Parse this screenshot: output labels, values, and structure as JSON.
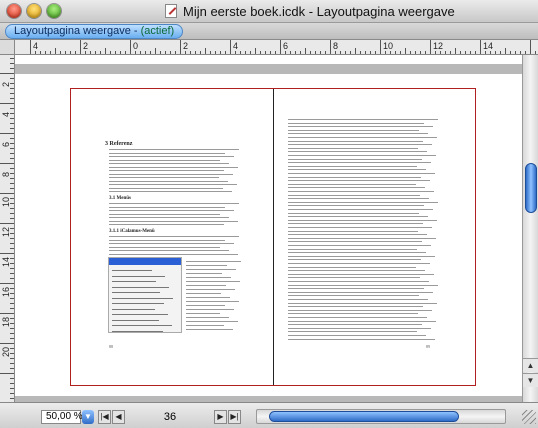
{
  "window": {
    "title": "Mijn eerste boek.icdk - Layoutpagina weergave",
    "traffic_lights": [
      "close",
      "minimize",
      "zoom"
    ]
  },
  "tab": {
    "name": "Layoutpagina weergave -",
    "state": "(actief)"
  },
  "ruler": {
    "horizontal_labels": [
      "4",
      "2",
      "0",
      "2",
      "4",
      "6",
      "8",
      "10",
      "12",
      "14"
    ],
    "vertical_labels": [
      "2",
      "4",
      "6",
      "8",
      "10",
      "12",
      "14",
      "16",
      "18",
      "20"
    ]
  },
  "document": {
    "left_page": {
      "heading": "3   Referenz",
      "subheading1": "3.1   Menüs",
      "subheading2": "3.1.1  iCalamus-Menü",
      "page_number": "88"
    },
    "right_page": {
      "page_number": "89"
    }
  },
  "statusbar": {
    "zoom": "50,00 %",
    "page": "36"
  },
  "icons": {
    "doc": "document-icon",
    "zoom_dropdown": "chevron-down-icon",
    "first_page": "first-page-icon",
    "prev_page": "prev-page-icon",
    "next_page": "next-page-icon",
    "last_page": "last-page-icon"
  }
}
